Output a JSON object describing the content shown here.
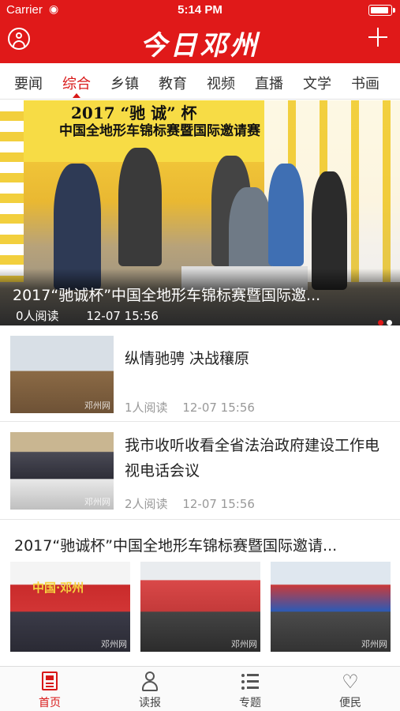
{
  "status": {
    "carrier": "Carrier",
    "time": "5:14 PM"
  },
  "header": {
    "logo": "今日邓州"
  },
  "tabs": [
    {
      "label": "要闻"
    },
    {
      "label": "综合"
    },
    {
      "label": "乡镇"
    },
    {
      "label": "教育"
    },
    {
      "label": "视频"
    },
    {
      "label": "直播"
    },
    {
      "label": "文学"
    },
    {
      "label": "书画"
    }
  ],
  "active_tab": "综合",
  "hero": {
    "banner_line1": "2017 “驰 诚” 杯",
    "banner_line2": "中国全地形车锦标赛暨国际邀请赛",
    "title": "2017“驰诚杯”中国全地形车锦标赛暨国际邀...",
    "reads": "0人阅读",
    "time": "12-07 15:56",
    "slide_count": 2,
    "active_slide": 1
  },
  "articles": [
    {
      "title": "纵情驰骋 决战穰原",
      "reads": "1人阅读",
      "time": "12-07 15:56",
      "watermark": "邓州网"
    },
    {
      "title": "我市收听收看全省法治政府建设工作电视电话会议",
      "reads": "2人阅读",
      "time": "12-07 15:56",
      "watermark": "邓州网"
    }
  ],
  "gallery": {
    "title": "2017“驰诚杯”中国全地形车锦标赛暨国际邀请...",
    "banner_text": "中国·邓州",
    "watermark": "邓州网"
  },
  "bottom_nav": [
    {
      "label": "首页",
      "icon": "news-icon"
    },
    {
      "label": "读报",
      "icon": "reader-icon"
    },
    {
      "label": "专题",
      "icon": "list-icon"
    },
    {
      "label": "便民",
      "icon": "heart-icon"
    }
  ],
  "colors": {
    "brand_red": "#e01919",
    "active_red": "#d81818"
  }
}
